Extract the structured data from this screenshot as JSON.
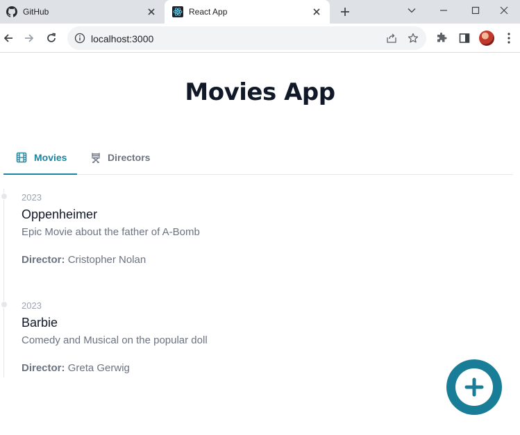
{
  "browser": {
    "tabs": [
      {
        "title": "GitHub",
        "favicon": "github-icon"
      },
      {
        "title": "React App",
        "favicon": "react-icon"
      }
    ],
    "url": "localhost:3000"
  },
  "app": {
    "title": "Movies App",
    "tabs": [
      {
        "label": "Movies",
        "icon": "film-icon"
      },
      {
        "label": "Directors",
        "icon": "director-chair-icon"
      }
    ],
    "movies": [
      {
        "year": "2023",
        "title": "Oppenheimer",
        "description": "Epic Movie about the father of A-Bomb",
        "director_label": "Director:",
        "director": "Cristopher Nolan"
      },
      {
        "year": "2023",
        "title": "Barbie",
        "description": "Comedy and Musical on the popular doll",
        "director_label": "Director:",
        "director": "Greta Gerwig"
      }
    ]
  },
  "colors": {
    "accent": "#1b849f",
    "fab": "#1a7d97",
    "title": "#111827",
    "muted": "#6b7280",
    "tab_strip": "#dee1e6"
  }
}
